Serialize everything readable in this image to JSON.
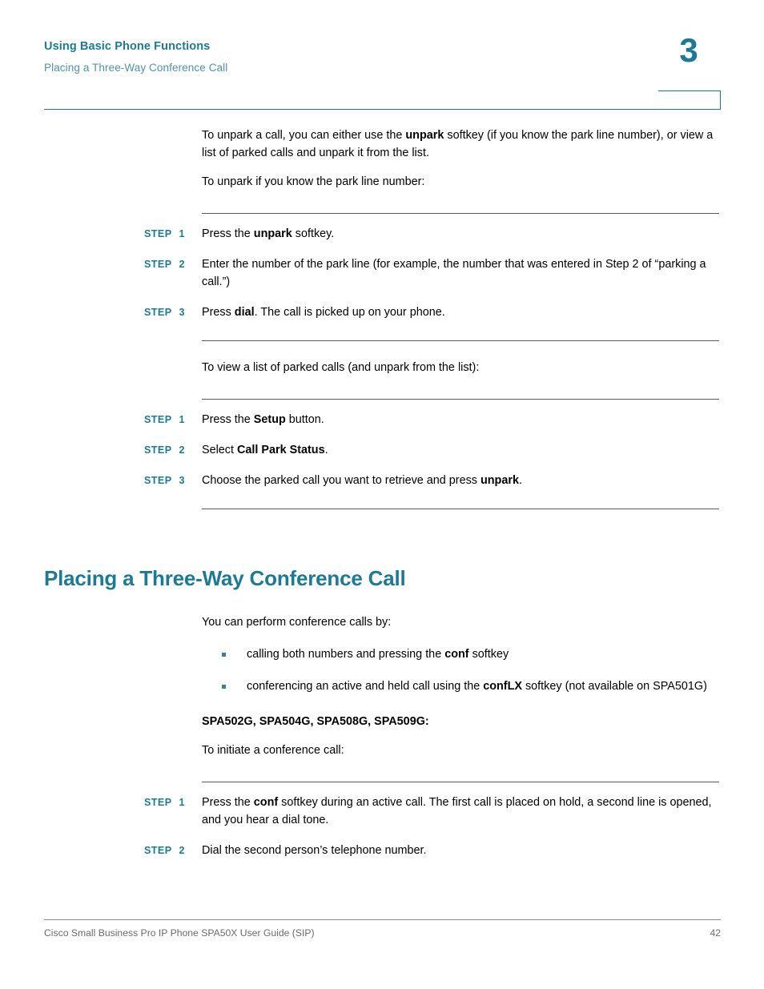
{
  "header": {
    "title": "Using Basic Phone Functions",
    "subtitle": "Placing a Three-Way Conference Call",
    "chapter_number": "3",
    "accent_color": "#1d7a96",
    "subtitle_color": "#4e93a8"
  },
  "intro": {
    "paragraph_1": {
      "part_1": "To unpark a call, you can either use the ",
      "bold_1": "unpark",
      "part_2": " softkey (if you know the park line number), or view a list of parked calls and unpark it from the list."
    },
    "paragraph_2": "To unpark if you know the park line number:"
  },
  "steps_group_1": [
    {
      "label": "STEP",
      "number": "1",
      "text": {
        "part_1": "Press the ",
        "bold_1": "unpark",
        "part_2": " softkey."
      }
    },
    {
      "label": "STEP",
      "number": "2",
      "text": {
        "part_1": "Enter the number of the park line (for example, the number that was entered in Step 2 of “parking a call.”)",
        "bold_1": "",
        "part_2": ""
      }
    },
    {
      "label": "STEP",
      "number": "3",
      "text": {
        "part_1": "Press ",
        "bold_1": "dial",
        "part_2": ". The call is picked up on your phone."
      }
    }
  ],
  "mid_paragraph": "To view a list of parked calls (and unpark from the list):",
  "steps_group_2": [
    {
      "label": "STEP",
      "number": "1",
      "text": {
        "part_1": "Press the ",
        "bold_1": "Setup",
        "part_2": " button."
      }
    },
    {
      "label": "STEP",
      "number": "2",
      "text": {
        "part_1": "Select ",
        "bold_1": "Call Park Status",
        "part_2": "."
      }
    },
    {
      "label": "STEP",
      "number": "3",
      "text": {
        "part_1": "Choose the parked call you want to retrieve and press ",
        "bold_1": "unpark",
        "part_2": "."
      }
    }
  ],
  "section": {
    "heading": "Placing a Three-Way Conference Call",
    "intro": "You can perform conference calls by:",
    "bullets": [
      {
        "part_1": "calling both numbers and pressing the ",
        "bold_1": "conf",
        "part_2": " softkey"
      },
      {
        "part_1": "conferencing an active and held call using the ",
        "bold_1": "confLX",
        "part_2": " softkey (not available on SPA501G)"
      }
    ],
    "bullet_color": "#3d7f96",
    "models_subhead": "SPA502G, SPA504G, SPA508G, SPA509G:",
    "initiate_text": "To initiate a conference call:"
  },
  "steps_group_3": [
    {
      "label": "STEP",
      "number": "1",
      "text": {
        "part_1": "Press the ",
        "bold_1": "conf",
        "part_2": " softkey during an active call. The first call is placed on hold, a second line is opened, and you hear a dial tone."
      }
    },
    {
      "label": "STEP",
      "number": "2",
      "text": {
        "part_1": "Dial the second person’s telephone number.",
        "bold_1": "",
        "part_2": ""
      }
    }
  ],
  "footer": {
    "document_title": "Cisco Small Business Pro IP Phone SPA50X User Guide (SIP)",
    "page_number": "42"
  }
}
